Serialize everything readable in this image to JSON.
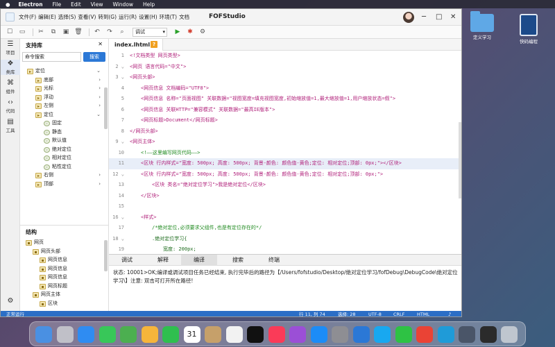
{
  "menubar": {
    "apple": "",
    "app": "Electron",
    "items": [
      "File",
      "Edit",
      "View",
      "Window",
      "Help"
    ]
  },
  "desktop": {
    "icons": [
      {
        "label": "定义学习"
      },
      {
        "label": "快码编程"
      }
    ]
  },
  "window": {
    "title": "FOFStudio",
    "menus": [
      "文件(F)",
      "编辑(E)",
      "选择(S)",
      "查看(V)",
      "转到(G)",
      "运行(R)",
      "设置(H)",
      "环境(T)",
      "文档"
    ],
    "controls": {
      "minimize": "─",
      "maximize": "□",
      "close": "✕"
    }
  },
  "toolbar": {
    "run_mode": "调试"
  },
  "activity": [
    {
      "label": "项目",
      "icon": "☰"
    },
    {
      "label": "类库",
      "icon": "❖"
    },
    {
      "label": "组件",
      "icon": "⌘"
    },
    {
      "label": "代码",
      "icon": "‹›"
    },
    {
      "label": "工具",
      "icon": "▤"
    }
  ],
  "library": {
    "title": "支持库",
    "search_placeholder": "命令搜索",
    "search_button": "搜索",
    "items": [
      {
        "label": "定位",
        "depth": 0,
        "kind": "folder",
        "expanded": true
      },
      {
        "label": "底部",
        "depth": 1,
        "kind": "folder"
      },
      {
        "label": "光标",
        "depth": 1,
        "kind": "folder"
      },
      {
        "label": "浮动",
        "depth": 1,
        "kind": "folder"
      },
      {
        "label": "左侧",
        "depth": 1,
        "kind": "folder"
      },
      {
        "label": "定位",
        "depth": 1,
        "kind": "folder",
        "expanded": true
      },
      {
        "label": "固定",
        "depth": 2,
        "kind": "comp"
      },
      {
        "label": "静态",
        "depth": 2,
        "kind": "comp"
      },
      {
        "label": "默认值",
        "depth": 2,
        "kind": "comp"
      },
      {
        "label": "绝对定位",
        "depth": 2,
        "kind": "comp"
      },
      {
        "label": "相对定位",
        "depth": 2,
        "kind": "comp"
      },
      {
        "label": "粘性定位",
        "depth": 2,
        "kind": "comp"
      },
      {
        "label": "右侧",
        "depth": 1,
        "kind": "folder"
      },
      {
        "label": "顶部",
        "depth": 1,
        "kind": "folder"
      }
    ]
  },
  "structure": {
    "title": "结构",
    "items": [
      {
        "label": "网页",
        "depth": 0
      },
      {
        "label": "网页头部",
        "depth": 1
      },
      {
        "label": "网页信息",
        "depth": 2
      },
      {
        "label": "网页信息",
        "depth": 2
      },
      {
        "label": "网页信息",
        "depth": 2
      },
      {
        "label": "网页标题",
        "depth": 2
      },
      {
        "label": "网页主体",
        "depth": 1
      },
      {
        "label": "区块",
        "depth": 2
      }
    ]
  },
  "editor": {
    "tab_label": "index.lhtml",
    "tab_close": "?",
    "lines": [
      {
        "num": "1",
        "text": "<!文档类型 网页类型>",
        "kind": "tag",
        "indent": 0
      },
      {
        "num": "2",
        "text": "<网页 语言代码=\"中文\">",
        "kind": "tag",
        "indent": 0
      },
      {
        "num": "3",
        "text": "<网页头部>",
        "kind": "tag",
        "indent": 0
      },
      {
        "num": "4",
        "text": "<网页信息 文档编码=\"UTF8\">",
        "kind": "tag",
        "indent": 1
      },
      {
        "num": "5",
        "text": "<网页信息 名称=\"页面视图\" 关联数据=\"视图宽度=填充视图宽度,初始缩放值=1,最大缩放值=1,用户缩放状态=假\">",
        "kind": "tag",
        "indent": 1
      },
      {
        "num": "6",
        "text": "<网页信息 关联HTTP=\"兼容模式\" 关联数据=\"最高IE版本\">",
        "kind": "tag",
        "indent": 1
      },
      {
        "num": "7",
        "text": "<网页标题>Document</网页标题>",
        "kind": "tag",
        "indent": 1
      },
      {
        "num": "8",
        "text": "</网页头部>",
        "kind": "tag",
        "indent": 0
      },
      {
        "num": "9",
        "text": "<网页主体>",
        "kind": "tag",
        "indent": 0
      },
      {
        "num": "10",
        "text": "<!——这里编写网页代码——>",
        "kind": "comment",
        "indent": 1
      },
      {
        "num": "11",
        "text": "<区块 行内样式=\"宽度: 500px; 高度: 500px; 背景-颜色: 颜色值-黄色;定位: 相对定位;顶部: 0px;\"></区块>",
        "kind": "tag",
        "indent": 1
      },
      {
        "num": "12",
        "text": "<区块 行内样式=\"宽度: 500px; 高度: 500px; 背景-颜色: 颜色值-黄色;定位: 相对定位;顶部: 0px;\">",
        "kind": "tag",
        "indent": 1
      },
      {
        "num": "13",
        "text": "<区块 类名=\"绝对定位学习\">我是绝对定位</区块>",
        "kind": "tag",
        "indent": 2
      },
      {
        "num": "14",
        "text": "</区块>",
        "kind": "tag",
        "indent": 1
      },
      {
        "num": "15",
        "text": "",
        "kind": "blank",
        "indent": 0
      },
      {
        "num": "16",
        "text": "<样式>",
        "kind": "tag",
        "indent": 1
      },
      {
        "num": "17",
        "text": "/*绝对定位,必须要求父组件,也是有定位存在的*/",
        "kind": "comment",
        "indent": 2
      },
      {
        "num": "18",
        "text": ".绝对定位学习{",
        "kind": "css",
        "indent": 2
      },
      {
        "num": "19",
        "text": "宽度: 200px;",
        "kind": "css",
        "indent": 3
      }
    ],
    "current_line": "11"
  },
  "bottom": {
    "tabs": [
      "调试",
      "解释",
      "编译",
      "搜索",
      "终端"
    ],
    "active_tab": "编译",
    "message": "状态: 10001>OK;编译或调试项目任务已经结束, 执行完毕后的路径为【/Users/fofstudio/Desktop/绝对定位学习/fofDebug\\DebugCode\\绝对定位学习\\】注意: 双击可打开所在路径!"
  },
  "status": {
    "left": "正常运行",
    "position": "行 11, 列 74",
    "spaces": "选择: 28",
    "encoding": "UTF-8",
    "eol": "CRLF",
    "lang": "HTML"
  },
  "colors": {
    "accent": "#2b78d6",
    "statusbar": "#2b6ec6",
    "tag": "#b0207a",
    "comment": "#1f8a1f"
  },
  "dock": {
    "icons": [
      "finder",
      "launchpad",
      "safari",
      "messages",
      "maps",
      "photos",
      "facetime",
      "calendar",
      "contacts",
      "reminders",
      "appletv",
      "music",
      "podcasts",
      "appstore",
      "settings",
      "fofstudio",
      "qq",
      "wechat",
      "chrome",
      "edge",
      "electron",
      "terminal",
      "trash"
    ],
    "calendar_day": "31"
  }
}
